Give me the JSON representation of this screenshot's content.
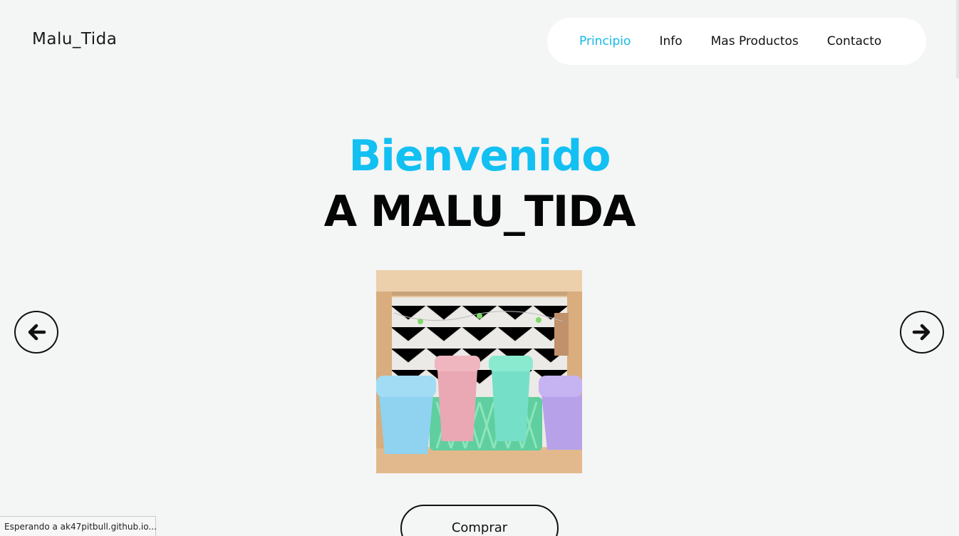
{
  "header": {
    "brand": "Malu_Tida",
    "nav": [
      {
        "label": "Principio",
        "active": true
      },
      {
        "label": "Info",
        "active": false
      },
      {
        "label": "Mas Productos",
        "active": false
      },
      {
        "label": "Contacto",
        "active": false
      }
    ]
  },
  "hero": {
    "title": "Bienvenido",
    "subtitle": "A MALU_TIDA"
  },
  "carousel": {
    "prev_icon": "arrow-left-icon",
    "next_icon": "arrow-right-icon",
    "image": "pastel-cups-in-basket"
  },
  "cta": {
    "buy_label": "Comprar"
  },
  "status": {
    "text": "Esperando a ak47pitbull.github.io..."
  },
  "colors": {
    "accent": "#14b8e6",
    "background": "#f4f5f5",
    "text": "#050505"
  }
}
